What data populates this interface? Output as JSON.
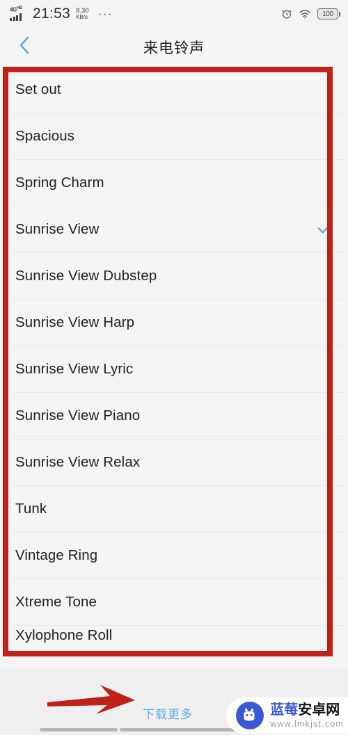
{
  "status_bar": {
    "network_type": "4G",
    "network_sub": "HD",
    "time": "21:53",
    "net_speed_value": "8.30",
    "net_speed_unit": "KB/s",
    "overflow_dots": "···",
    "alarm_icon": "alarm-clock-icon",
    "wifi_icon": "wifi-icon",
    "battery_level": "100"
  },
  "header": {
    "back_icon": "chevron-left-icon",
    "title": "来电铃声"
  },
  "list": {
    "selected": "Sunrise View",
    "check_icon": "check-icon",
    "items": [
      {
        "label": "Set out",
        "selected": false
      },
      {
        "label": "Spacious",
        "selected": false
      },
      {
        "label": "Spring Charm",
        "selected": false
      },
      {
        "label": "Sunrise View",
        "selected": true
      },
      {
        "label": "Sunrise View Dubstep",
        "selected": false
      },
      {
        "label": "Sunrise View Harp",
        "selected": false
      },
      {
        "label": "Sunrise View Lyric",
        "selected": false
      },
      {
        "label": "Sunrise View Piano",
        "selected": false
      },
      {
        "label": "Sunrise View Relax",
        "selected": false
      },
      {
        "label": "Tunk",
        "selected": false
      },
      {
        "label": "Vintage Ring",
        "selected": false
      },
      {
        "label": "Xtreme Tone",
        "selected": false
      },
      {
        "label": "Xylophone Roll",
        "selected": false
      }
    ]
  },
  "footer": {
    "download_more": "下载更多"
  },
  "annotations": {
    "box_color": "#bf2017",
    "arrow_color": "#bf2017",
    "arrow_icon": "red-arrow-pointing-right",
    "box_icon": "red-highlight-rectangle"
  },
  "watermark": {
    "name_blue": "蓝莓",
    "name_dark": "安卓网",
    "url": "www.lmkjst.com",
    "logo_icon": "android-robot-logo",
    "logo_color": "#3b59d6"
  },
  "nav_bar": {
    "pill_left": "nav-pill-left",
    "pill_right": "nav-pill-right"
  }
}
